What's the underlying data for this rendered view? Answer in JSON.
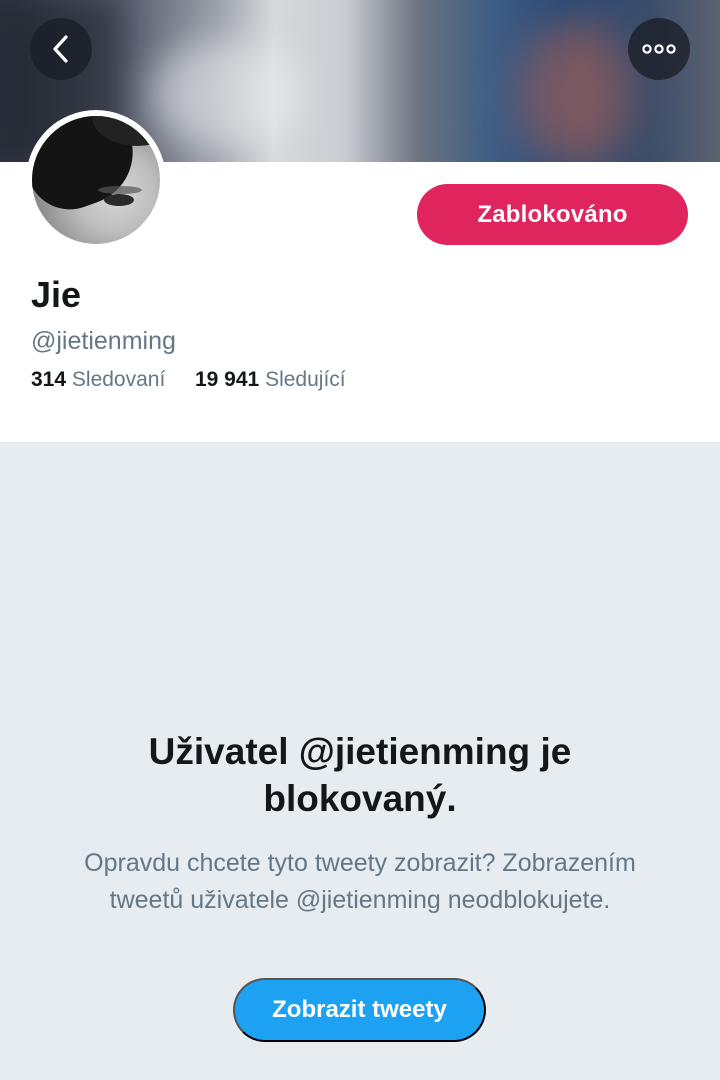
{
  "header": {
    "back_icon": "chevron-left-icon",
    "more_icon": "more-horizontal-icon"
  },
  "profile": {
    "name": "Jie",
    "handle": "@jietienming",
    "following_count": "314",
    "following_label": "Sledovaní",
    "followers_count": "19 941",
    "followers_label": "Sledující",
    "blocked_button_label": "Zablokováno"
  },
  "blocked_notice": {
    "title": "Uživatel @jietienming je blokovaný.",
    "description": "Opravdu chcete tyto tweety zobrazit? Zobrazením tweetů uživatele @jietienming neodblokujete.",
    "button_label": "Zobrazit tweety"
  },
  "colors": {
    "blocked_accent": "#e0245e",
    "primary_blue": "#1da1f2",
    "secondary_text": "#657786",
    "background": "#e6ecf0"
  }
}
